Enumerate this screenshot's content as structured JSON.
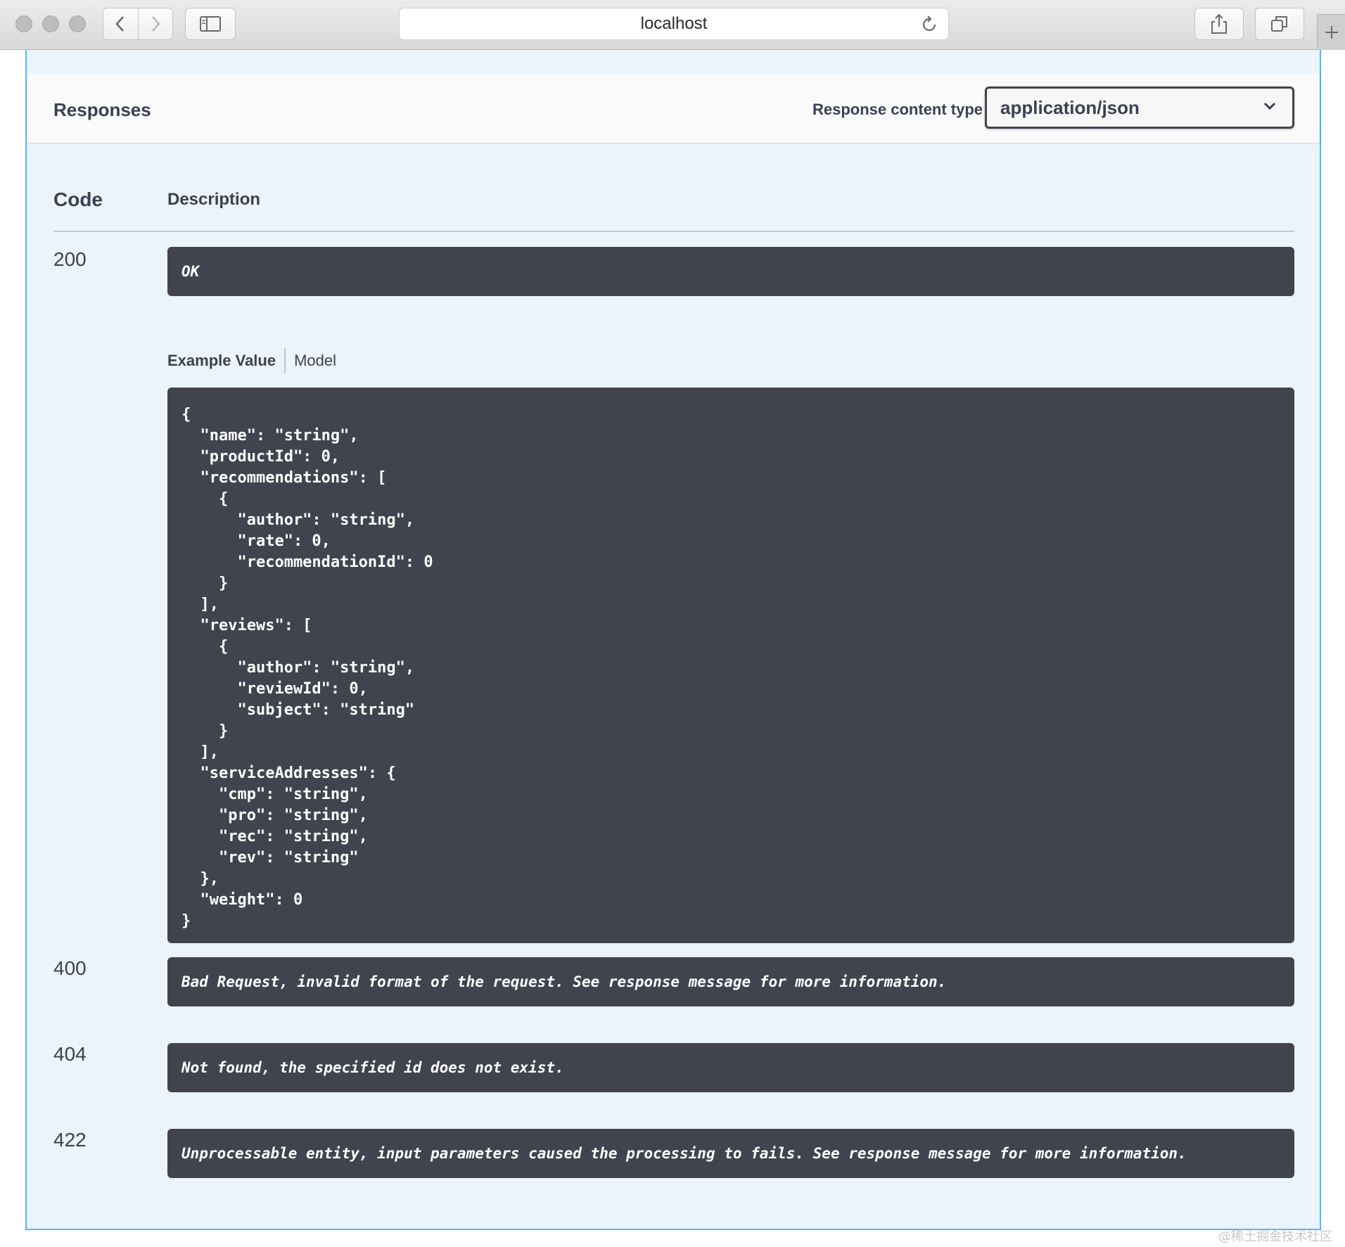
{
  "browser": {
    "address": "localhost"
  },
  "responses": {
    "title": "Responses",
    "content_type_label": "Response content type",
    "content_type_value": "application/json",
    "columns": {
      "code": "Code",
      "description": "Description"
    },
    "tabs": {
      "example": "Example Value",
      "model": "Model"
    },
    "items": [
      {
        "code": "200",
        "description": "OK"
      },
      {
        "code": "400",
        "description": "Bad Request, invalid format of the request. See response message for more information."
      },
      {
        "code": "404",
        "description": "Not found, the specified id does not exist."
      },
      {
        "code": "422",
        "description": "Unprocessable entity, input parameters caused the processing to fails. See response message for more information."
      }
    ],
    "example_value": "{\n  \"name\": \"string\",\n  \"productId\": 0,\n  \"recommendations\": [\n    {\n      \"author\": \"string\",\n      \"rate\": 0,\n      \"recommendationId\": 0\n    }\n  ],\n  \"reviews\": [\n    {\n      \"author\": \"string\",\n      \"reviewId\": 0,\n      \"subject\": \"string\"\n    }\n  ],\n  \"serviceAddresses\": {\n    \"cmp\": \"string\",\n    \"pro\": \"string\",\n    \"rec\": \"string\",\n    \"rev\": \"string\"\n  },\n  \"weight\": 0\n}"
  },
  "watermark": "@稀土掘金技术社区",
  "colors": {
    "accent_border": "#61affe",
    "block_background": "#ebf3fb",
    "code_background": "#41444e"
  }
}
